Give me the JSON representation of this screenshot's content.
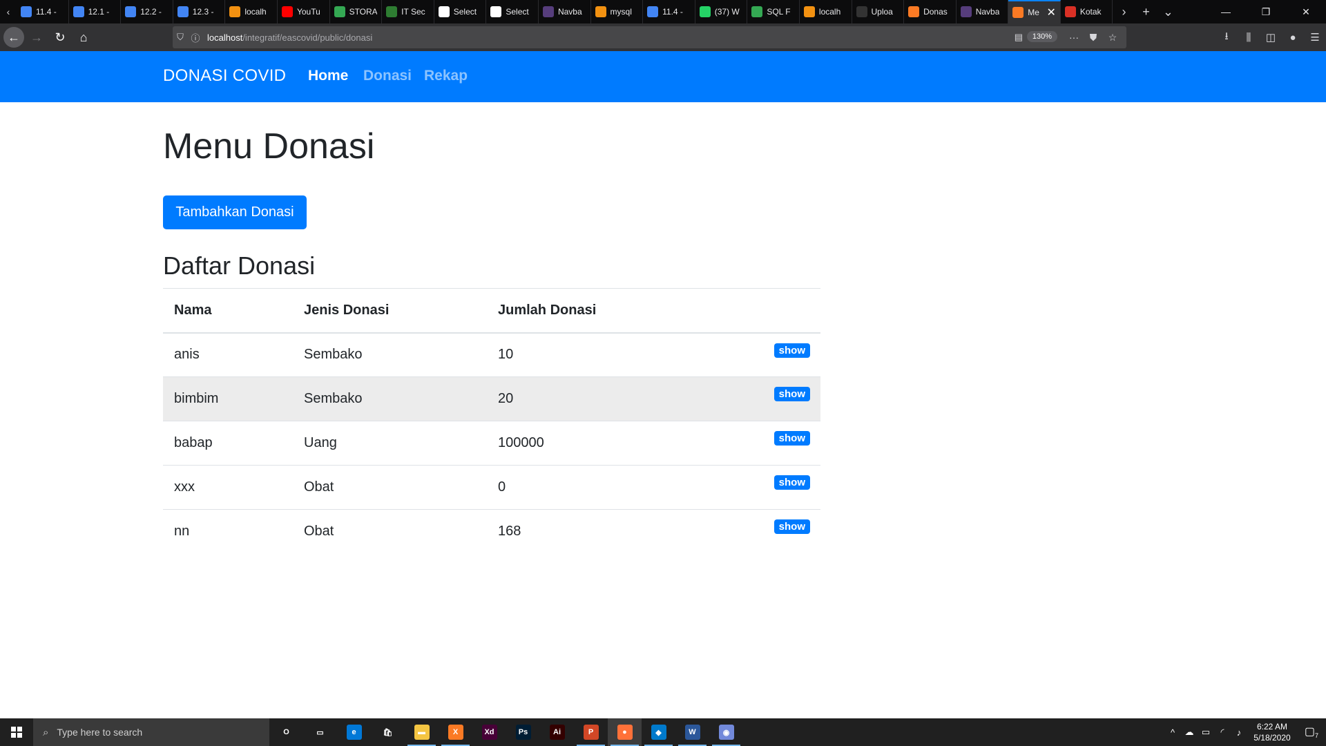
{
  "browser": {
    "tabs": [
      {
        "label": "11.4 -",
        "icon": "docs-icon",
        "color": "#4285f4"
      },
      {
        "label": "12.1 -",
        "icon": "docs-icon",
        "color": "#4285f4"
      },
      {
        "label": "12.2 -",
        "icon": "docs-icon",
        "color": "#4285f4"
      },
      {
        "label": "12.3 -",
        "icon": "docs-icon",
        "color": "#4285f4"
      },
      {
        "label": "localh",
        "icon": "phpmyadmin-icon",
        "color": "#f29111"
      },
      {
        "label": "YouTu",
        "icon": "youtube-icon",
        "color": "#ff0000"
      },
      {
        "label": "STORA",
        "icon": "drive-icon",
        "color": "#34a853"
      },
      {
        "label": "IT Sec",
        "icon": "shield-icon",
        "color": "#2e7d32"
      },
      {
        "label": "Select",
        "icon": "page-icon",
        "color": "#ffffff"
      },
      {
        "label": "Select",
        "icon": "page-icon",
        "color": "#ffffff"
      },
      {
        "label": "Navba",
        "icon": "bootstrap-icon",
        "color": "#563d7c"
      },
      {
        "label": "mysql",
        "icon": "phpmyadmin-icon",
        "color": "#f29111"
      },
      {
        "label": "11.4 -",
        "icon": "docs-icon",
        "color": "#4285f4"
      },
      {
        "label": "(37) W",
        "icon": "whatsapp-icon",
        "color": "#25d366"
      },
      {
        "label": "SQL F",
        "icon": "sql-icon",
        "color": "#34a853"
      },
      {
        "label": "localh",
        "icon": "phpmyadmin-icon",
        "color": "#f29111"
      },
      {
        "label": "Uploa",
        "icon": "github-icon",
        "color": "#333333"
      },
      {
        "label": "Donas",
        "icon": "xampp-icon",
        "color": "#fb7a24"
      },
      {
        "label": "Navba",
        "icon": "bootstrap-icon",
        "color": "#563d7c"
      },
      {
        "label": "Me",
        "icon": "xampp-icon",
        "color": "#fb7a24",
        "active": true
      },
      {
        "label": "Kotak",
        "icon": "gmail-icon",
        "color": "#d93025"
      }
    ],
    "url_host": "localhost",
    "url_path": "/integratif/eascovid/public/donasi",
    "zoom": "130%"
  },
  "site": {
    "brand": "DONASI COVID",
    "nav": {
      "home": "Home",
      "donasi": "Donasi",
      "rekap": "Rekap"
    }
  },
  "page": {
    "title": "Menu Donasi",
    "add_button": "Tambahkan Donasi",
    "list_title": "Daftar Donasi"
  },
  "table": {
    "headers": [
      "Nama",
      "Jenis Donasi",
      "Jumlah Donasi"
    ],
    "rows": [
      {
        "nama": "anis",
        "jenis": "Sembako",
        "jumlah": "10",
        "action": "show"
      },
      {
        "nama": "bimbim",
        "jenis": "Sembako",
        "jumlah": "20",
        "action": "show"
      },
      {
        "nama": "babap",
        "jenis": "Uang",
        "jumlah": "100000",
        "action": "show"
      },
      {
        "nama": "xxx",
        "jenis": "Obat",
        "jumlah": "0",
        "action": "show"
      },
      {
        "nama": "nn",
        "jenis": "Obat",
        "jumlah": "168",
        "action": "show"
      }
    ]
  },
  "taskbar": {
    "search_placeholder": "Type here to search",
    "apps": [
      {
        "name": "cortana-icon",
        "label": "O",
        "color": "transparent"
      },
      {
        "name": "task-view-icon",
        "label": "▭",
        "color": "transparent"
      },
      {
        "name": "edge-icon",
        "label": "e",
        "color": "#0078d7"
      },
      {
        "name": "store-icon",
        "label": "🛍",
        "color": "transparent"
      },
      {
        "name": "file-explorer-icon",
        "label": "▬",
        "color": "#f4c542",
        "open": true
      },
      {
        "name": "xampp-icon",
        "label": "X",
        "color": "#fb7a24",
        "open": true
      },
      {
        "name": "adobe-xd-icon",
        "label": "Xd",
        "color": "#470137"
      },
      {
        "name": "photoshop-icon",
        "label": "Ps",
        "color": "#001d34"
      },
      {
        "name": "illustrator-icon",
        "label": "Ai",
        "color": "#330000"
      },
      {
        "name": "powerpoint-icon",
        "label": "P",
        "color": "#d24726",
        "open": true
      },
      {
        "name": "firefox-icon",
        "label": "●",
        "color": "#ff7139",
        "open": true,
        "active": true
      },
      {
        "name": "vscode-icon",
        "label": "◆",
        "color": "#007acc",
        "open": true
      },
      {
        "name": "word-icon",
        "label": "W",
        "color": "#2b579a",
        "open": true
      },
      {
        "name": "discord-icon",
        "label": "◉",
        "color": "#7289da",
        "open": true
      }
    ],
    "time": "6:22 AM",
    "date": "5/18/2020",
    "notification_count": "7"
  }
}
